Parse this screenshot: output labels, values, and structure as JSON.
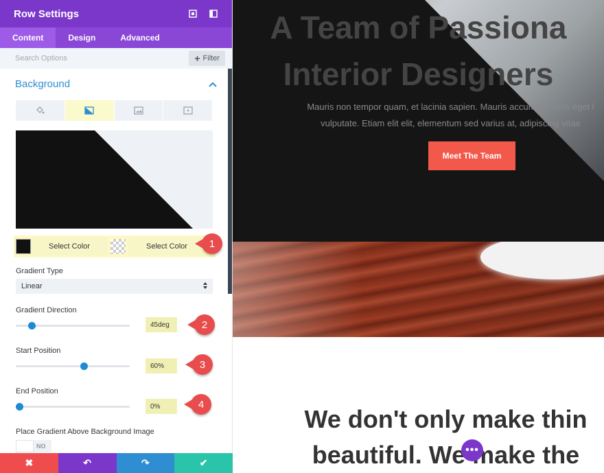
{
  "panel": {
    "title": "Row Settings",
    "tabs": [
      "Content",
      "Design",
      "Advanced"
    ],
    "search_placeholder": "Search Options",
    "filter_label": "Filter",
    "section_title": "Background",
    "color_row": {
      "first_label": "Select Color",
      "second_label": "Select Color"
    },
    "gradient_type": {
      "label": "Gradient Type",
      "value": "Linear"
    },
    "gradient_direction": {
      "label": "Gradient Direction",
      "value": "45deg"
    },
    "start_position": {
      "label": "Start Position",
      "value": "60%"
    },
    "end_position": {
      "label": "End Position",
      "value": "0%"
    },
    "place_gradient": {
      "label": "Place Gradient Above Background Image",
      "toggle": "NO"
    },
    "badges": [
      "1",
      "2",
      "3",
      "4"
    ],
    "footer": {
      "cancel": "✖",
      "undo": "↶",
      "redo": "↷",
      "save": "✔"
    },
    "colors": {
      "header": "#7b37c9",
      "tab_bar": "#8a46d6",
      "accent": "#2e8ed1",
      "badge": "#e84c4c",
      "cancel": "#ef4d4d",
      "undo": "#7b37c9",
      "redo": "#2e8ed1",
      "save": "#29c4a9"
    }
  },
  "preview": {
    "hero_title_line1": "A Team of Passiona",
    "hero_title_line2": "Interior Designers",
    "hero_sub_line1": "Mauris non tempor quam, et lacinia sapien. Mauris accumsan eros eget l",
    "hero_sub_line2": "vulputate. Etiam elit elit, elementum sed varius at, adipiscing vitae",
    "hero_button": "Meet The Team",
    "bottom_line1": "We don't only make thin",
    "bottom_line2": "beautiful. We make the",
    "dots": "•••"
  }
}
